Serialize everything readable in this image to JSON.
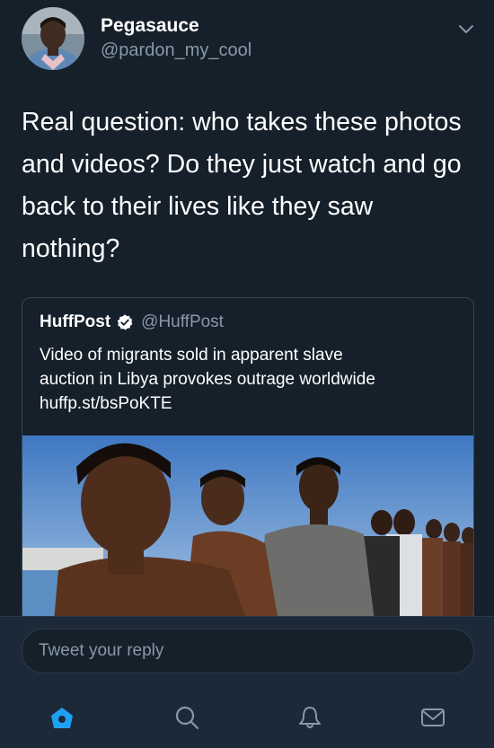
{
  "tweet": {
    "author_name": "Pegasauce",
    "author_handle": "@pardon_my_cool",
    "text": "Real question: who takes these photos and videos? Do they just watch and go back to their lives like they saw nothing?",
    "menu_icon": "chevron-down-icon"
  },
  "quoted_tweet": {
    "author_name": "HuffPost",
    "verified": true,
    "author_handle": "@HuffPost",
    "text_line1": "Video of migrants sold in apparent slave",
    "text_line2": "auction in Libya provokes outrage worldwide",
    "link": "huffp.st/bsPoKTE"
  },
  "reply": {
    "placeholder": "Tweet your reply"
  },
  "tabs": [
    {
      "name": "home",
      "icon": "home-icon",
      "active": true
    },
    {
      "name": "search",
      "icon": "search-icon",
      "active": false
    },
    {
      "name": "notifications",
      "icon": "bell-icon",
      "active": false
    },
    {
      "name": "messages",
      "icon": "mail-icon",
      "active": false
    }
  ],
  "colors": {
    "background": "#15202b",
    "secondary_text": "#8899a6",
    "accent": "#1da1f2",
    "border": "#38444d"
  }
}
